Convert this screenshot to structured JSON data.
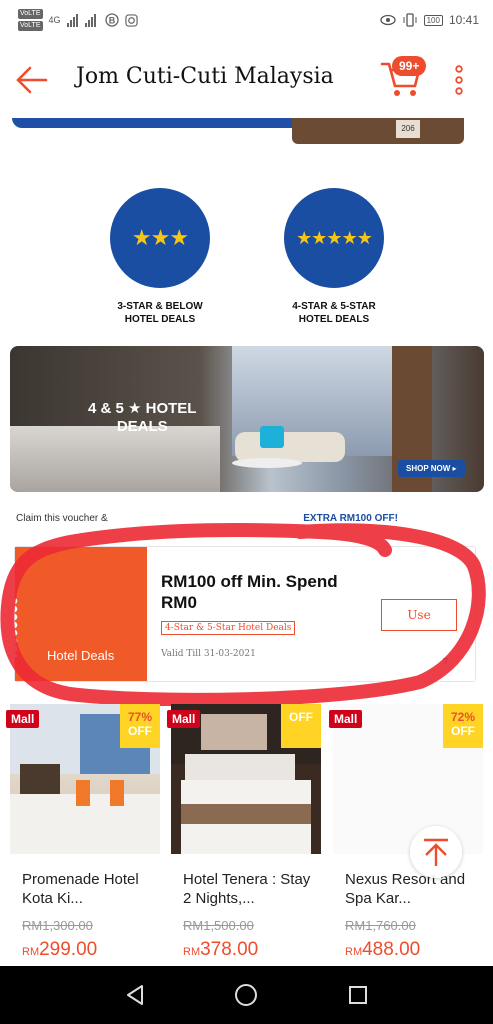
{
  "status_bar": {
    "tag1": "VoLTE",
    "tag2": "VoLTE",
    "net1": "4G",
    "battery": "100",
    "time": "10:41"
  },
  "header": {
    "title": "Jom Cuti-Cuti Malaysia",
    "cart_badge": "99+",
    "accent_color": "#ee4d2d"
  },
  "top_photo": {
    "room_number": "206"
  },
  "categories": [
    {
      "stars": "★★★",
      "label_line1": "3-STAR & BELOW",
      "label_line2": "HOTEL DEALS"
    },
    {
      "stars": "★★★★★",
      "label_line1": "4-STAR & 5-STAR",
      "label_line2": "HOTEL DEALS"
    }
  ],
  "banner": {
    "title_line1": "4 & 5 ★ HOTEL",
    "title_line2": "DEALS",
    "cta": "SHOP NOW ▸"
  },
  "claim": {
    "text": "Claim this voucher & ",
    "highlight": "EXTRA RM100 OFF!"
  },
  "voucher": {
    "left_label": "Hotel Deals",
    "title_line1": "RM100 off Min. Spend",
    "title_line2": "RM0",
    "tag": "4-Star & 5-Star Hotel Deals",
    "valid": "Valid Till 31-03-2021",
    "use_label": "Use",
    "tc": "T"
  },
  "products": [
    {
      "mall": "Mall",
      "off_pct": "77%",
      "off_word": "OFF",
      "name": "Promenade Hotel Kota Ki...",
      "old_price": "RM1,300.00",
      "currency": "RM",
      "price": "299.00"
    },
    {
      "mall": "Mall",
      "off_pct": "",
      "off_word": "OFF",
      "name": "Hotel Tenera : Stay 2 Nights,...",
      "old_price": "RM1,500.00",
      "currency": "RM",
      "price": "378.00"
    },
    {
      "mall": "Mall",
      "off_pct": "72%",
      "off_word": "OFF",
      "name": "Nexus Resort and Spa Kar...",
      "old_price": "RM1,760.00",
      "currency": "RM",
      "price": "488.00"
    }
  ]
}
